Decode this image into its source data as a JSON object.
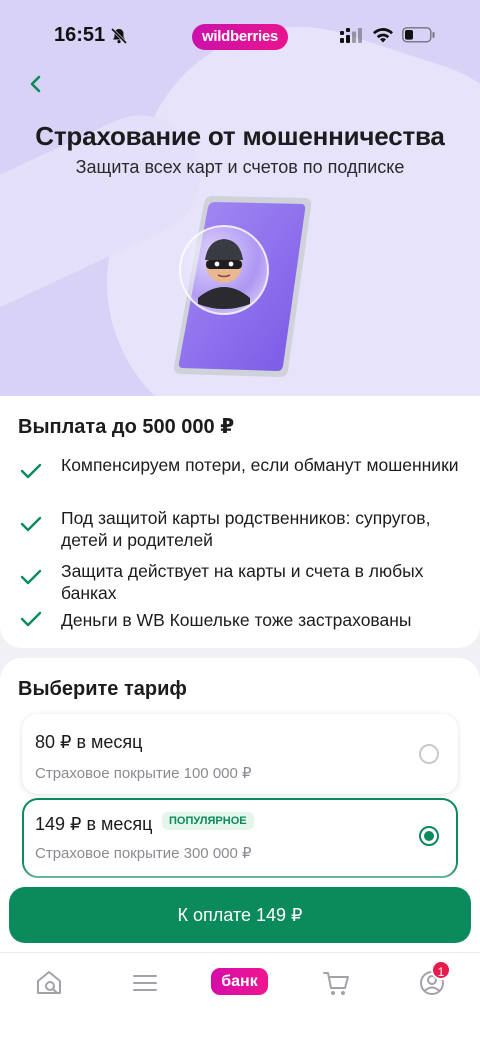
{
  "status_bar": {
    "time": "16:51",
    "brand": "wildberries"
  },
  "header": {
    "title": "Страхование от мошенничества",
    "subtitle": "Защита всех карт и счетов по подписке"
  },
  "payout": {
    "title": "Выплата до 500 000 ₽",
    "benefits": [
      "Компенсируем потери, если обманут мошенники",
      "Под защитой карты родственников: супругов, детей и родителей",
      "Защита действует на карты и счета в любых банках",
      "Деньги в WB Кошельке тоже застрахованы"
    ]
  },
  "tariff": {
    "title": "Выберите тариф",
    "options": [
      {
        "price": "80 ₽ в месяц",
        "coverage": "Страховое покрытие 100 000 ₽",
        "selected": false
      },
      {
        "price": "149 ₽ в месяц",
        "coverage": "Страховое покрытие 300 000 ₽",
        "selected": true,
        "badge": "ПОПУЛЯРНОЕ"
      }
    ]
  },
  "pay_button": {
    "label": "К оплате 149 ₽"
  },
  "bottom_nav": {
    "bank_label": "банк",
    "profile_badge": "1",
    "icons": [
      "home-search-icon",
      "menu-icon",
      "bank-tab",
      "cart-icon",
      "profile-icon"
    ]
  },
  "colors": {
    "accent_green": "#0b8a5b",
    "brand_pink": "#cb11ab",
    "hero_bg": "#d8d3f6"
  }
}
